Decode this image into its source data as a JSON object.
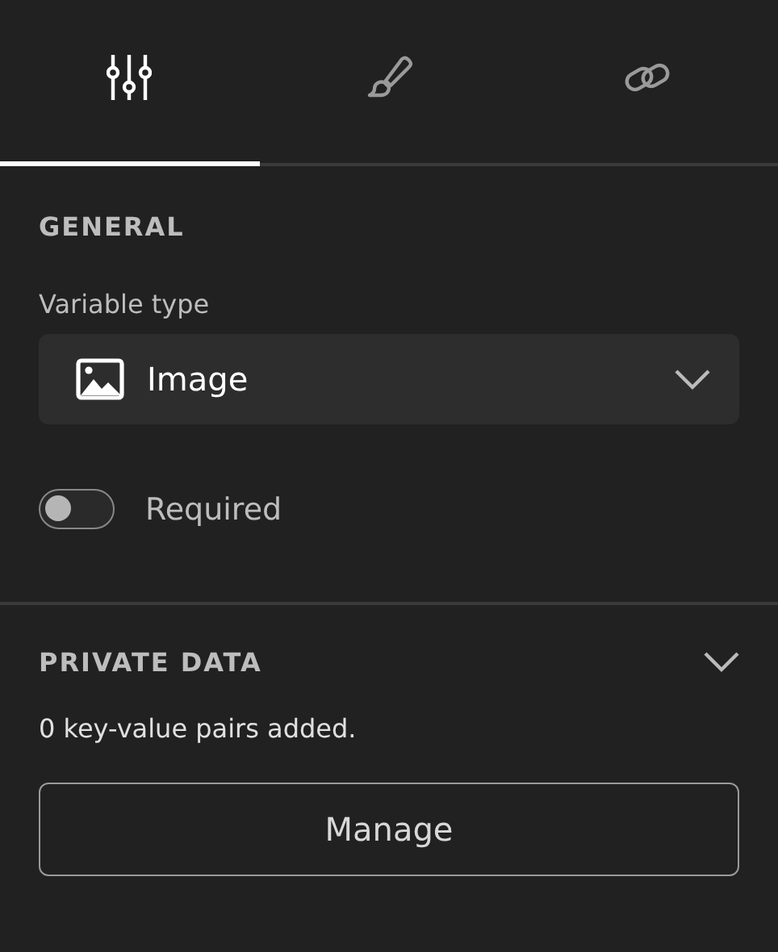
{
  "tabs": [
    {
      "kind": "sliders",
      "selected": true
    },
    {
      "kind": "brush",
      "selected": false
    },
    {
      "kind": "link",
      "selected": false
    }
  ],
  "general": {
    "heading": "GENERAL",
    "variable_type": {
      "label": "Variable type",
      "value": "Image",
      "kind": "image"
    },
    "required": {
      "label": "Required",
      "on": false
    }
  },
  "private_data": {
    "heading": "PRIVATE DATA",
    "expanded": true,
    "summary": "0 key-value pairs added.",
    "button": "Manage"
  }
}
